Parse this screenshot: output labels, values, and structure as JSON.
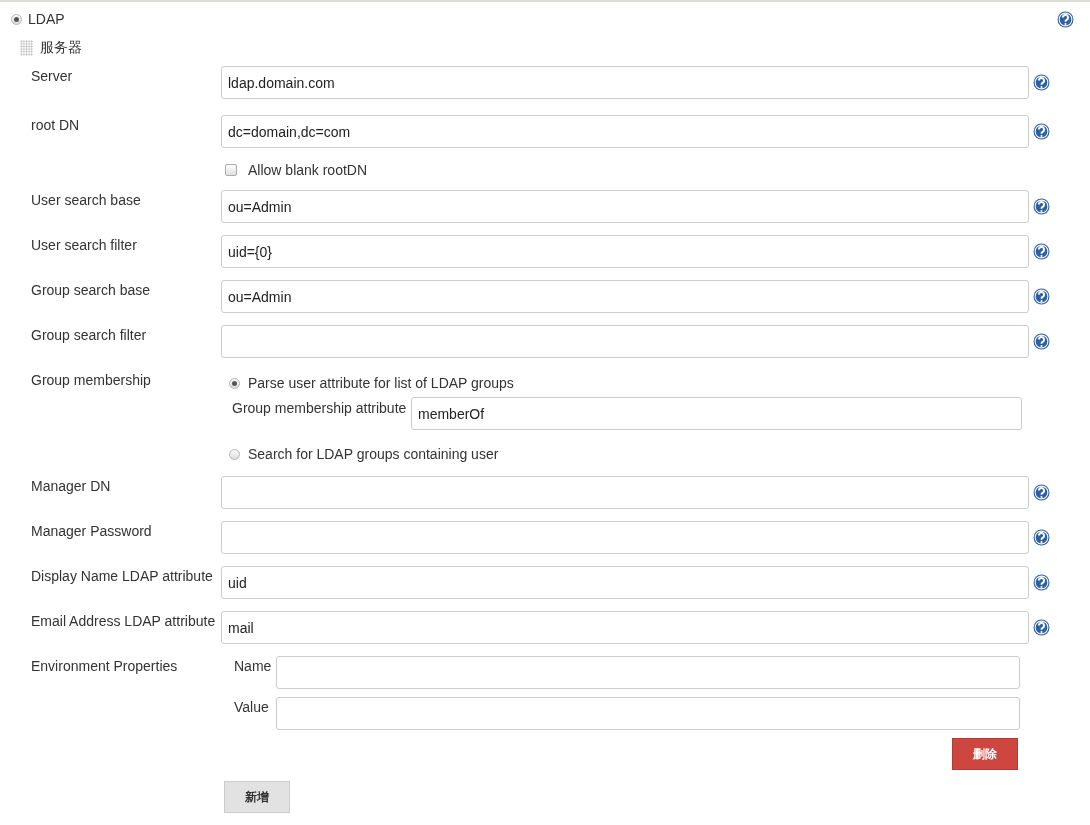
{
  "realm": {
    "label": "LDAP",
    "selected": true
  },
  "section": {
    "title": "服务器"
  },
  "fields": [
    {
      "kind": "text",
      "label": "Server",
      "value": "ldap.domain.com"
    },
    {
      "kind": "text",
      "label": "root DN",
      "value": "dc=domain,dc=com",
      "checkbox": {
        "label": "Allow blank rootDN",
        "checked": false
      }
    },
    {
      "kind": "text",
      "label": "User search base",
      "value": "ou=Admin"
    },
    {
      "kind": "text",
      "label": "User search filter",
      "value": "uid={0}"
    },
    {
      "kind": "text",
      "label": "Group search base",
      "value": "ou=Admin"
    },
    {
      "kind": "text",
      "label": "Group search filter"
    },
    {
      "kind": "radios",
      "label": "Group membership",
      "options": [
        {
          "label": "Parse user attribute for list of LDAP groups",
          "selected": true,
          "sub_label": "Group membership attribute",
          "sub_value": "memberOf"
        },
        {
          "label": "Search for LDAP groups containing user",
          "selected": false
        }
      ]
    },
    {
      "kind": "text",
      "label": "Manager DN"
    },
    {
      "kind": "text",
      "label": "Manager Password"
    },
    {
      "kind": "text",
      "label": "Display Name LDAP attribute",
      "value": "uid"
    },
    {
      "kind": "text",
      "label": "Email Address LDAP attribute",
      "value": "mail"
    },
    {
      "kind": "env",
      "label": "Environment Properties",
      "entries": [
        {
          "name_label": "Name",
          "value_label": "Value"
        }
      ],
      "delete_button": "删除",
      "add_button": "新增"
    }
  ]
}
